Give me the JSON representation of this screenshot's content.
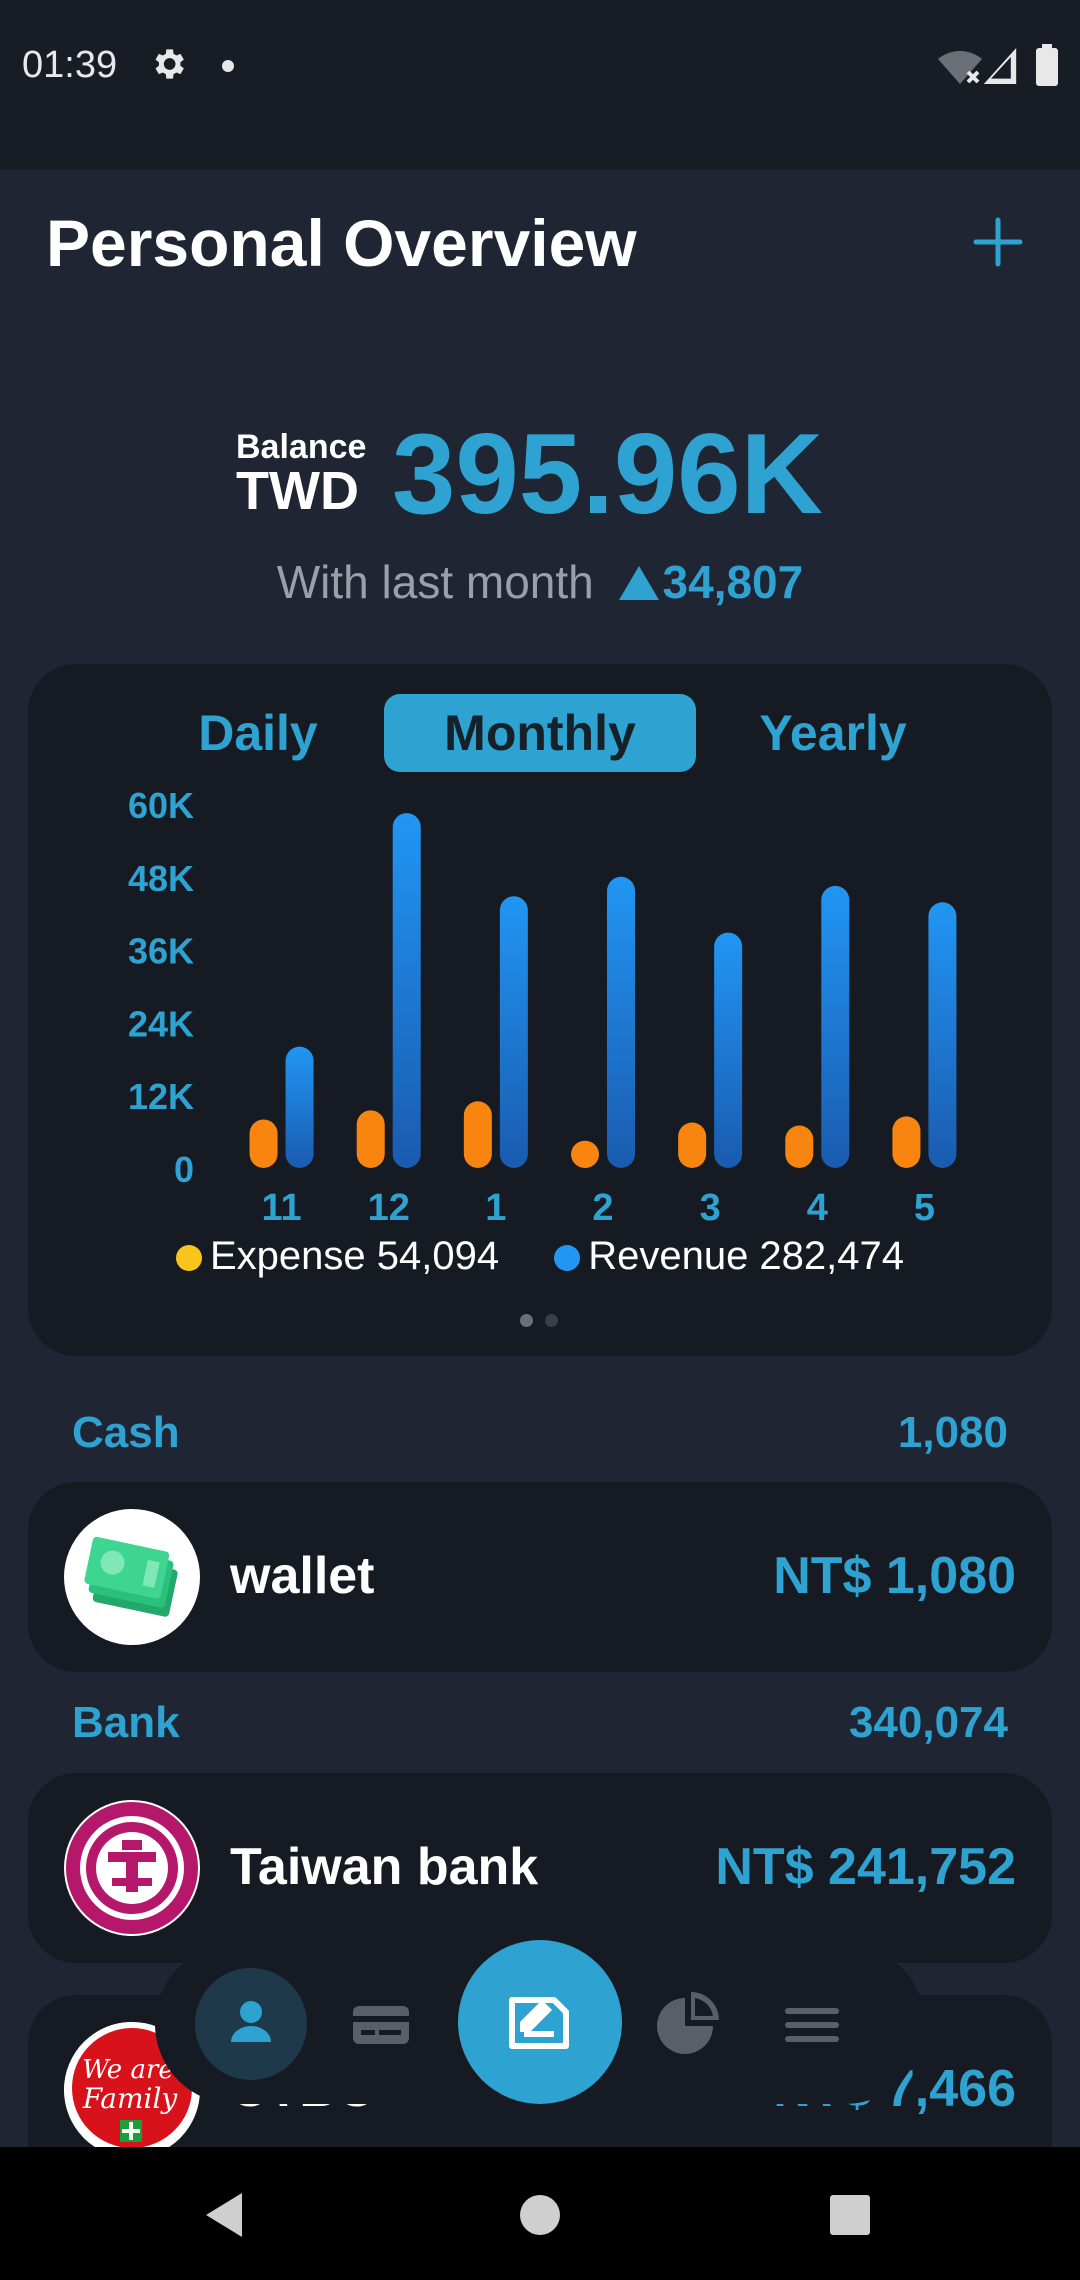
{
  "status_bar": {
    "time": "01:39"
  },
  "header": {
    "title": "Personal Overview",
    "add_icon": "plus-icon"
  },
  "balance": {
    "label": "Balance",
    "currency": "TWD",
    "value": "395.96K",
    "last_month_label": "With last month",
    "last_month_delta": "34,807"
  },
  "chart": {
    "tabs": [
      "Daily",
      "Monthly",
      "Yearly"
    ],
    "active_tab": "Monthly",
    "legend": {
      "expense": "Expense 54,094",
      "revenue": "Revenue 282,474"
    }
  },
  "chart_data": {
    "type": "bar",
    "categories": [
      "11",
      "12",
      "1",
      "2",
      "3",
      "4",
      "5"
    ],
    "series": [
      {
        "name": "Expense",
        "color": "#f7850f",
        "values": [
          8000,
          9500,
          11000,
          4500,
          7500,
          7000,
          8500
        ]
      },
      {
        "name": "Revenue",
        "color": "#1f8fe8",
        "values": [
          20000,
          58500,
          44800,
          48000,
          38800,
          46500,
          43800
        ]
      }
    ],
    "ylim": [
      0,
      60000
    ],
    "yticks": [
      "0",
      "12K",
      "24K",
      "36K",
      "48K",
      "60K"
    ],
    "xlabel": "",
    "ylabel": ""
  },
  "sections": [
    {
      "label": "Cash",
      "total": "1,080",
      "accounts": [
        {
          "name": "wallet",
          "amount": "NT$ 1,080",
          "logo": "cash-logo"
        }
      ]
    },
    {
      "label": "Bank",
      "total": "340,074",
      "accounts": [
        {
          "name": "Taiwan bank",
          "amount": "NT$ 241,752",
          "logo": "taiwan-bank-logo"
        },
        {
          "name": "CTBC",
          "amount": "NT$ 7,466",
          "logo": "family-mart-logo"
        }
      ]
    }
  ],
  "bottom_nav": {
    "items": [
      "person-icon",
      "card-icon",
      "transaction-icon",
      "pie-chart-icon",
      "menu-icon"
    ],
    "active": "person-icon"
  },
  "colors": {
    "accent": "#2ea3d1",
    "background": "#1f2533",
    "card": "#161b23",
    "expense": "#f7850f",
    "revenue": "#1f8fe8"
  }
}
